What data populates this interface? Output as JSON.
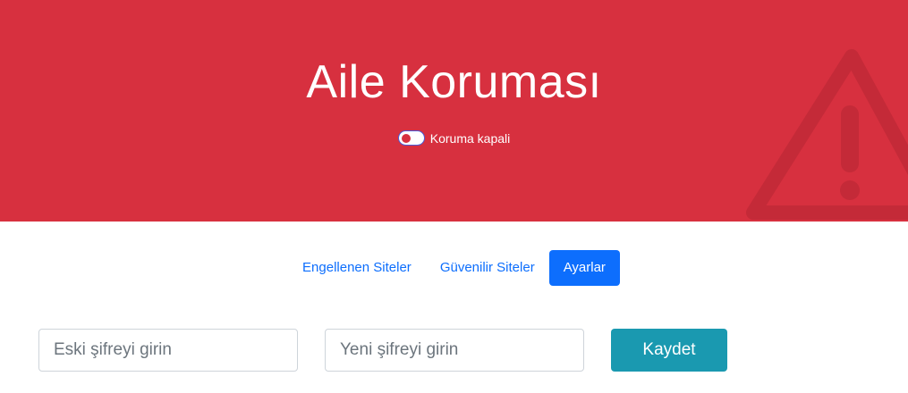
{
  "hero": {
    "title": "Aile Koruması",
    "toggle_label": "Koruma kapali",
    "toggle_on": false,
    "background_color": "#d7303f",
    "icon": "warning-triangle-icon"
  },
  "tabs": [
    {
      "label": "Engellenen Siteler",
      "active": false
    },
    {
      "label": "Güvenilir Siteler",
      "active": false
    },
    {
      "label": "Ayarlar",
      "active": true
    }
  ],
  "settings_form": {
    "old_password_placeholder": "Eski şifreyi girin",
    "new_password_placeholder": "Yeni şifreyi girin",
    "save_label": "Kaydet",
    "save_color": "#1a99b0"
  },
  "accent_color": "#0d6efd"
}
